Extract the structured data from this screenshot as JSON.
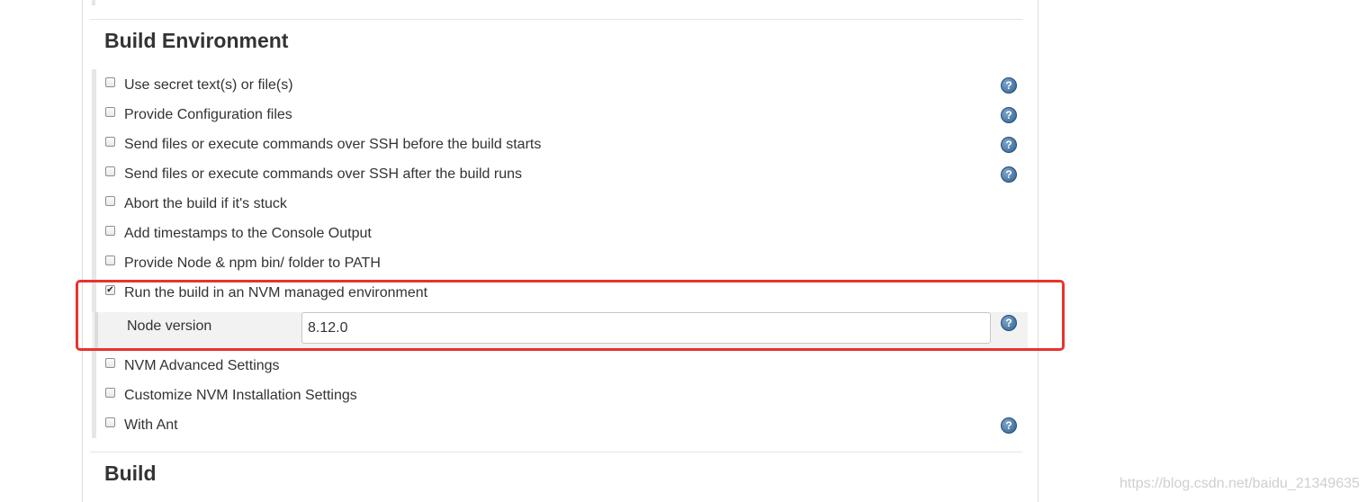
{
  "build_environment": {
    "title": "Build Environment",
    "options": [
      {
        "label": "Use secret text(s) or file(s)",
        "checked": false,
        "help": true
      },
      {
        "label": "Provide Configuration files",
        "checked": false,
        "help": true
      },
      {
        "label": "Send files or execute commands over SSH before the build starts",
        "checked": false,
        "help": true
      },
      {
        "label": "Send files or execute commands over SSH after the build runs",
        "checked": false,
        "help": true
      },
      {
        "label": "Abort the build if it's stuck",
        "checked": false,
        "help": false
      },
      {
        "label": "Add timestamps to the Console Output",
        "checked": false,
        "help": false
      },
      {
        "label": "Provide Node & npm bin/ folder to PATH",
        "checked": false,
        "help": false
      },
      {
        "label": "Run the build in an NVM managed environment",
        "checked": true,
        "help": false
      },
      {
        "label": "NVM Advanced Settings",
        "checked": false,
        "help": false
      },
      {
        "label": "Customize NVM Installation Settings",
        "checked": false,
        "help": false
      },
      {
        "label": "With Ant",
        "checked": false,
        "help": true
      }
    ],
    "nvm": {
      "node_version_label": "Node version",
      "node_version_value": "8.12.0"
    }
  },
  "build": {
    "title": "Build"
  },
  "icons": {
    "help": "question-mark-help-icon",
    "check": "checkmark-icon"
  },
  "glyphs": {
    "help": "?",
    "check": "✔"
  },
  "colors": {
    "highlight": "#e8332f",
    "help_icon": "#2e5f8f",
    "section_bar": "#e6e6e6"
  },
  "watermark": "https://blog.csdn.net/baidu_21349635"
}
